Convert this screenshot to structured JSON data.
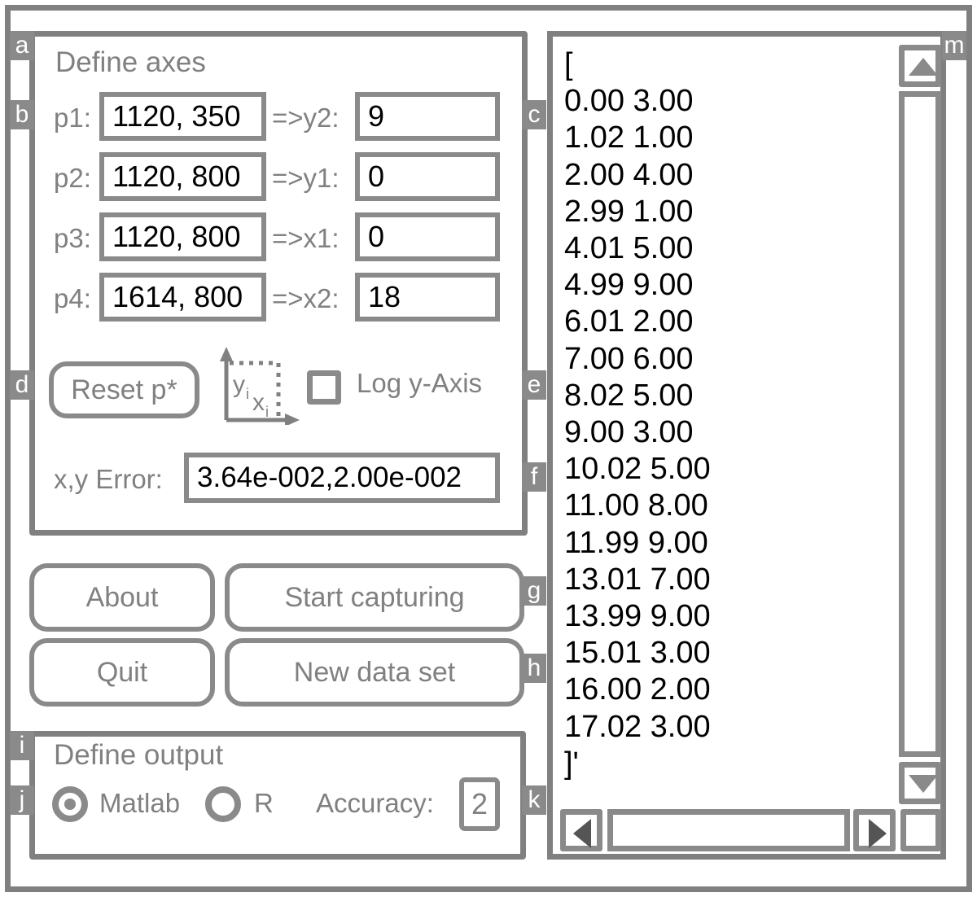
{
  "colors": {
    "frame": "#808080",
    "control_border": "#8a8a8a",
    "label_text": "#808080",
    "value_text": "#000000",
    "tag_bg": "#8a8a8a",
    "tag_text": "#ffffff",
    "background": "#ffffff"
  },
  "axes_panel": {
    "title": "Define axes",
    "rows": [
      {
        "point_label": "p1:",
        "point_value": "1120, 350",
        "map_label": "=>y2:",
        "map_value": "9"
      },
      {
        "point_label": "p2:",
        "point_value": "1120, 800",
        "map_label": "=>y1:",
        "map_value": "0"
      },
      {
        "point_label": "p3:",
        "point_value": "1120, 800",
        "map_label": "=>x1:",
        "map_value": "0"
      },
      {
        "point_label": "p4:",
        "point_value": "1614, 800",
        "map_label": "=>x2:",
        "map_value": "18"
      }
    ],
    "reset_button": "Reset p*",
    "axis_icon": {
      "y_label": "y",
      "y_sub": "i",
      "x_label": "x",
      "x_sub": "i"
    },
    "log_checkbox": {
      "label": "Log y-Axis",
      "checked": false
    },
    "error": {
      "label": "x,y Error:",
      "value": "3.64e-002,2.00e-002"
    }
  },
  "actions": {
    "about": "About",
    "start_capturing": "Start capturing",
    "quit": "Quit",
    "new_data_set": "New data set"
  },
  "output_panel": {
    "title": "Define output",
    "options": [
      {
        "label": "Matlab",
        "selected": true
      },
      {
        "label": "R",
        "selected": false
      }
    ],
    "accuracy_label": "Accuracy:",
    "accuracy_value": "2"
  },
  "data_list": {
    "text": "[\n0.00 3.00\n1.02 1.00\n2.00 4.00\n2.99 1.00\n4.01 5.00\n4.99 9.00\n6.01 2.00\n7.00 6.00\n8.02 5.00\n9.00 3.00\n10.02 5.00\n11.00 8.00\n11.99 9.00\n13.01 7.00\n13.99 9.00\n15.01 3.00\n16.00 2.00\n17.02 3.00\n]'",
    "open_bracket": "[",
    "close_bracket": "]'",
    "points": [
      {
        "x": "0.00",
        "y": "3.00"
      },
      {
        "x": "1.02",
        "y": "1.00"
      },
      {
        "x": "2.00",
        "y": "4.00"
      },
      {
        "x": "2.99",
        "y": "1.00"
      },
      {
        "x": "4.01",
        "y": "5.00"
      },
      {
        "x": "4.99",
        "y": "9.00"
      },
      {
        "x": "6.01",
        "y": "2.00"
      },
      {
        "x": "7.00",
        "y": "6.00"
      },
      {
        "x": "8.02",
        "y": "5.00"
      },
      {
        "x": "9.00",
        "y": "3.00"
      },
      {
        "x": "10.02",
        "y": "5.00"
      },
      {
        "x": "11.00",
        "y": "8.00"
      },
      {
        "x": "11.99",
        "y": "9.00"
      },
      {
        "x": "13.01",
        "y": "7.00"
      },
      {
        "x": "13.99",
        "y": "9.00"
      },
      {
        "x": "15.01",
        "y": "3.00"
      },
      {
        "x": "16.00",
        "y": "2.00"
      },
      {
        "x": "17.02",
        "y": "3.00"
      }
    ]
  },
  "tags": {
    "a": "a",
    "b": "b",
    "c": "c",
    "d": "d",
    "e": "e",
    "f": "f",
    "g": "g",
    "h": "h",
    "i": "i",
    "j": "j",
    "k": "k",
    "m": "m"
  }
}
